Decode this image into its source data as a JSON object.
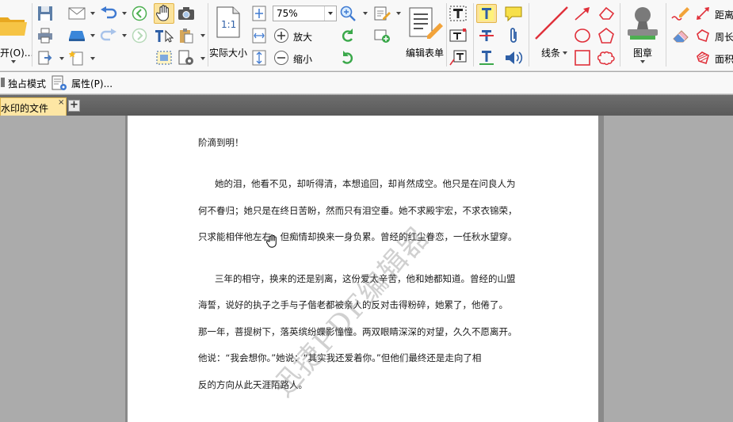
{
  "ribbon": {
    "open_label": "开(O)...",
    "actual_size_label": "实际大小",
    "zoom_value": "75%",
    "zoom_in_label": "放大",
    "zoom_out_label": "缩小",
    "edit_form_label": "编辑表单",
    "line_label": "线条",
    "stamp_label": "图章",
    "distance_label": "距离",
    "perimeter_label": "周长",
    "area_label": "面积"
  },
  "toolbar2": {
    "exclusive_mode_label": "独占模式",
    "properties_label": "属性(P)..."
  },
  "tabs": {
    "active_tab_label": "水印的文件",
    "close_glyph": "×",
    "new_tab_glyph": "+"
  },
  "document": {
    "lines": [
      "阶滴到明！",
      "她的泪，他看不见，却听得清，本想追回，却肖然成空。他只是在问良人为",
      "何不眷归；她只是在终日苦盼，然而只有泪空垂。她不求殿宇宏，不求衣锦荣，",
      "只求能相伴他左右，但痴情却换来一身负累。曾经的红尘眷恋，一任秋水望穿。",
      "三年的相守，换来的还是别离，这份爱太辛苦，他和她都知道。曾经的山盟",
      "海誓，说好的执子之手与子偕老都被亲人的反对击得粉碎，她累了，他倦了。",
      "那一年，菩提树下，落英缤纷蝶影憧憧。两双眼睛深深的对望，久久不愿离开。",
      "他说：“我会想你。”她说：“其实我还爱着你。”但他们最终还是走向了相",
      "反的方向从此天涯陌路人。"
    ],
    "watermark": "迅捷PDF编辑器"
  },
  "colors": {
    "ribbon_bg": "#f8f8f8",
    "tab_active": "#fde6a4",
    "highlight_yellow": "#fbe39c",
    "annotation_red": "#e0303a",
    "accent_blue": "#2a6fc9"
  }
}
